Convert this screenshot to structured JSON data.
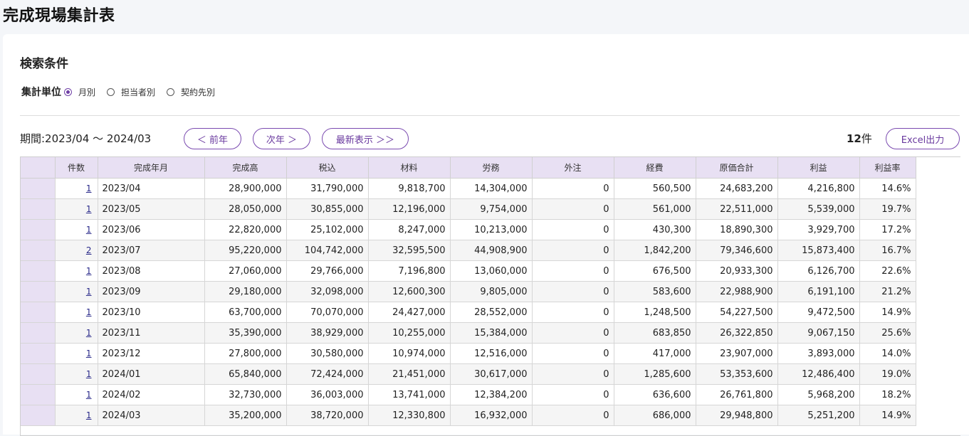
{
  "title": "完成現場集計表",
  "search": {
    "heading": "検索条件",
    "unit_label": "集計単位",
    "options": [
      {
        "label": "月別",
        "checked": true
      },
      {
        "label": "担当者別",
        "checked": false
      },
      {
        "label": "契約先別",
        "checked": false
      }
    ]
  },
  "toolbar": {
    "period_text": "期間:2023/04 ～ 2024/03",
    "prev_label": "＜ 前年",
    "next_label": "次年 ＞",
    "latest_label": "最新表示 ＞＞",
    "count_number": "12",
    "count_suffix": "件",
    "excel_label": "Excel出力"
  },
  "table": {
    "headers": [
      "件数",
      "完成年月",
      "完成高",
      "税込",
      "材料",
      "労務",
      "外注",
      "経費",
      "原価合計",
      "利益",
      "利益率"
    ],
    "rows": [
      [
        "1",
        "2023/04",
        "28,900,000",
        "31,790,000",
        "9,818,700",
        "14,304,000",
        "0",
        "560,500",
        "24,683,200",
        "4,216,800",
        "14.6%"
      ],
      [
        "1",
        "2023/05",
        "28,050,000",
        "30,855,000",
        "12,196,000",
        "9,754,000",
        "0",
        "561,000",
        "22,511,000",
        "5,539,000",
        "19.7%"
      ],
      [
        "1",
        "2023/06",
        "22,820,000",
        "25,102,000",
        "8,247,000",
        "10,213,000",
        "0",
        "430,300",
        "18,890,300",
        "3,929,700",
        "17.2%"
      ],
      [
        "2",
        "2023/07",
        "95,220,000",
        "104,742,000",
        "32,595,500",
        "44,908,900",
        "0",
        "1,842,200",
        "79,346,600",
        "15,873,400",
        "16.7%"
      ],
      [
        "1",
        "2023/08",
        "27,060,000",
        "29,766,000",
        "7,196,800",
        "13,060,000",
        "0",
        "676,500",
        "20,933,300",
        "6,126,700",
        "22.6%"
      ],
      [
        "1",
        "2023/09",
        "29,180,000",
        "32,098,000",
        "12,600,300",
        "9,805,000",
        "0",
        "583,600",
        "22,988,900",
        "6,191,100",
        "21.2%"
      ],
      [
        "1",
        "2023/10",
        "63,700,000",
        "70,070,000",
        "24,427,000",
        "28,552,000",
        "0",
        "1,248,500",
        "54,227,500",
        "9,472,500",
        "14.9%"
      ],
      [
        "1",
        "2023/11",
        "35,390,000",
        "38,929,000",
        "10,255,000",
        "15,384,000",
        "0",
        "683,850",
        "26,322,850",
        "9,067,150",
        "25.6%"
      ],
      [
        "1",
        "2023/12",
        "27,800,000",
        "30,580,000",
        "10,974,000",
        "12,516,000",
        "0",
        "417,000",
        "23,907,000",
        "3,893,000",
        "14.0%"
      ],
      [
        "1",
        "2024/01",
        "65,840,000",
        "72,424,000",
        "21,451,000",
        "30,617,000",
        "0",
        "1,285,600",
        "53,353,600",
        "12,486,400",
        "19.0%"
      ],
      [
        "1",
        "2024/02",
        "32,730,000",
        "36,003,000",
        "13,741,000",
        "12,384,200",
        "0",
        "636,600",
        "26,761,800",
        "5,968,200",
        "18.2%"
      ],
      [
        "1",
        "2024/03",
        "35,200,000",
        "38,720,000",
        "12,330,800",
        "16,932,000",
        "0",
        "686,000",
        "29,948,800",
        "5,251,200",
        "14.9%"
      ]
    ]
  }
}
